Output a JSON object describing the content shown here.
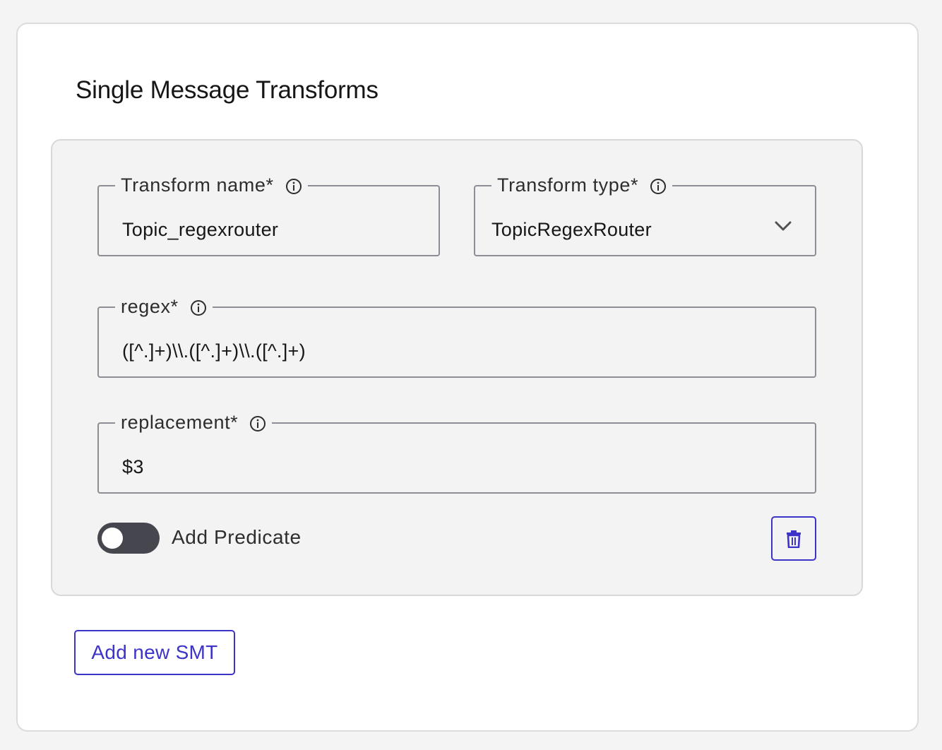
{
  "section": {
    "title": "Single Message Transforms"
  },
  "transform_name": {
    "label": "Transform name*",
    "value": "Topic_regexrouter"
  },
  "transform_type": {
    "label": "Transform type*",
    "value": "TopicRegexRouter"
  },
  "regex": {
    "label": "regex*",
    "value": "([^.]+)\\\\.([^.]+)\\\\.([^.]+)"
  },
  "replacement": {
    "label": "replacement*",
    "value": "$3"
  },
  "predicate_toggle": {
    "label": "Add Predicate",
    "checked": false
  },
  "actions": {
    "add_smt_label": "Add new SMT",
    "delete_icon": "trash-icon"
  },
  "colors": {
    "accent": "#3d33c9",
    "toggle_off": "#46464f",
    "field_border": "#8d8d95"
  }
}
